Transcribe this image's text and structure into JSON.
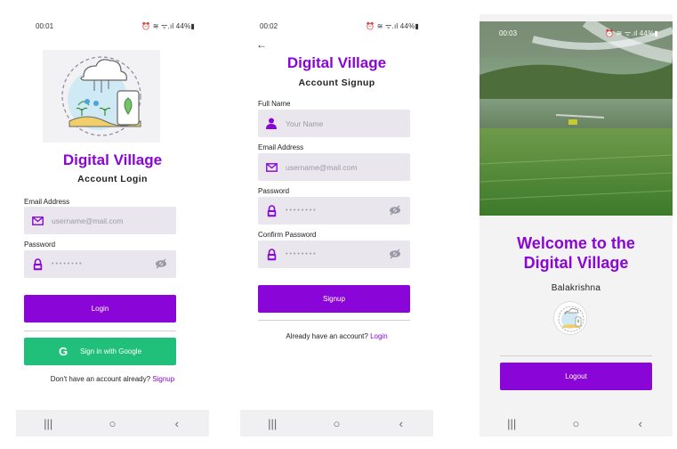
{
  "colors": {
    "brand": "#8a05d8",
    "google_green": "#21c07a",
    "field_bg": "#e9e6ee"
  },
  "login": {
    "status_time": "00:01",
    "status_right": "⏰ ≋ ᯤ.ıl 44%▮",
    "title": "Digital Village",
    "subtitle": "Account Login",
    "email_label": "Email Address",
    "email_placeholder": "username@mail.com",
    "password_label": "Password",
    "password_value": "••••••••",
    "login_button": "Login",
    "google_button": "Sign in with Google",
    "google_icon": "google-g-icon",
    "footer_text": "Don't have an account already?",
    "footer_link": "Signup"
  },
  "signup": {
    "status_time": "00:02",
    "status_right": "⏰ ≋ ᯤ.ıl 44%▮",
    "title": "Digital Village",
    "subtitle": "Account Signup",
    "name_label": "Full Name",
    "name_placeholder": "Your Name",
    "email_label": "Email Address",
    "email_placeholder": "username@mail.com",
    "password_label": "Password",
    "password_value": "••••••••",
    "confirm_label": "Confirm Password",
    "confirm_value": "••••••••",
    "signup_button": "Signup",
    "footer_text": "Already have an account?",
    "footer_link": "Login"
  },
  "welcome": {
    "status_time": "00:03",
    "status_right": "⏰ ≋ ᯤ.ıl 44%▮",
    "heading_line1": "Welcome to the",
    "heading_line2": "Digital Village",
    "user_name": "Balakrishna",
    "logout_button": "Logout"
  },
  "navbar": {
    "recents": "|||",
    "home": "○",
    "back": "‹"
  }
}
